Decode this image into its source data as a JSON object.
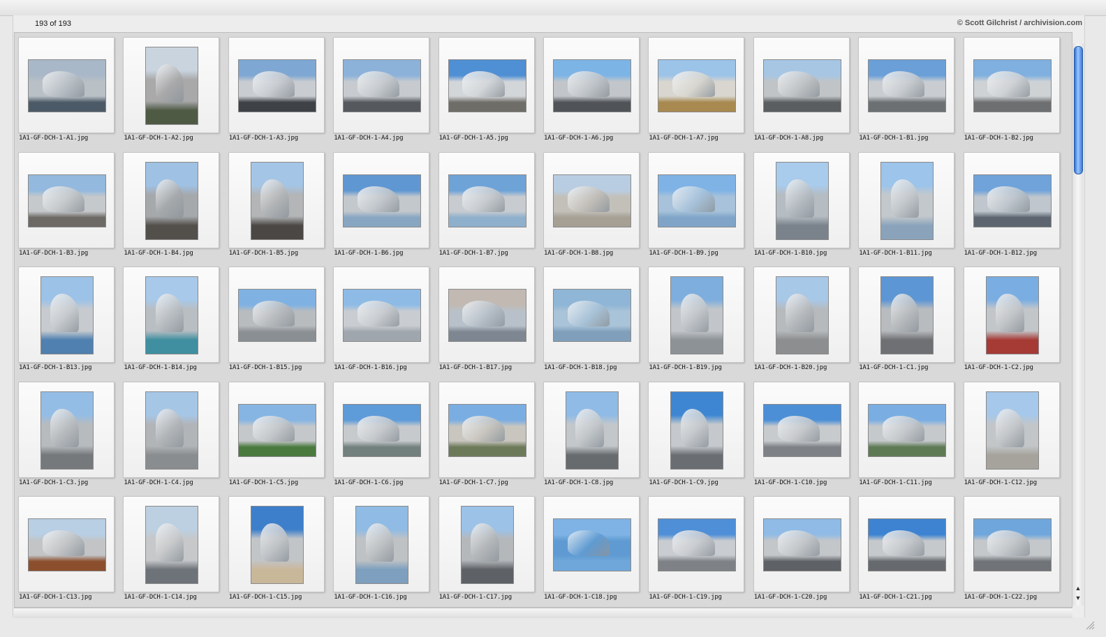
{
  "window": {
    "count_label": "193 of 193",
    "credit": "© Scott Gilchrist / archivision.com"
  },
  "thumbnails": [
    {
      "name": "1A1-GF-DCH-1-A1.jpg",
      "orient": "landscape",
      "palette": [
        "#a9b8c8",
        "#b9c0c6",
        "#4c5a68"
      ]
    },
    {
      "name": "1A1-GF-DCH-1-A2.jpg",
      "orient": "portrait",
      "palette": [
        "#c9d4df",
        "#a9a9aa",
        "#4f5a45"
      ]
    },
    {
      "name": "1A1-GF-DCH-1-A3.jpg",
      "orient": "landscape",
      "palette": [
        "#7fa7d3",
        "#c9ccd1",
        "#3e4247"
      ]
    },
    {
      "name": "1A1-GF-DCH-1-A4.jpg",
      "orient": "landscape",
      "palette": [
        "#8cb2da",
        "#c7cbcf",
        "#55585c"
      ]
    },
    {
      "name": "1A1-GF-DCH-1-A5.jpg",
      "orient": "landscape",
      "palette": [
        "#4f8fd3",
        "#d3d6d9",
        "#6f6d68"
      ]
    },
    {
      "name": "1A1-GF-DCH-1-A6.jpg",
      "orient": "landscape",
      "palette": [
        "#7db4e6",
        "#c2c6ca",
        "#505458"
      ]
    },
    {
      "name": "1A1-GF-DCH-1-A7.jpg",
      "orient": "landscape",
      "palette": [
        "#9cc3e8",
        "#d8d6cf",
        "#a8894f"
      ]
    },
    {
      "name": "1A1-GF-DCH-1-A8.jpg",
      "orient": "landscape",
      "palette": [
        "#a7c6e4",
        "#c1c4c6",
        "#5a5e60"
      ]
    },
    {
      "name": "1A1-GF-DCH-1-B1.jpg",
      "orient": "landscape",
      "palette": [
        "#6a9fd8",
        "#c9cdd1",
        "#6c7072"
      ]
    },
    {
      "name": "1A1-GF-DCH-1-B2.jpg",
      "orient": "landscape",
      "palette": [
        "#7fb0e0",
        "#cfd2d5",
        "#6d6f71"
      ]
    },
    {
      "name": "1A1-GF-DCH-1-B3.jpg",
      "orient": "landscape",
      "palette": [
        "#93b9de",
        "#c6c9cb",
        "#6d6a66"
      ]
    },
    {
      "name": "1A1-GF-DCH-1-B4.jpg",
      "orient": "portrait",
      "palette": [
        "#9fc1e3",
        "#a6a9ac",
        "#534f4b"
      ]
    },
    {
      "name": "1A1-GF-DCH-1-B5.jpg",
      "orient": "portrait",
      "palette": [
        "#a5c5e6",
        "#b3b5b7",
        "#4a4744"
      ]
    },
    {
      "name": "1A1-GF-DCH-1-B6.jpg",
      "orient": "landscape",
      "palette": [
        "#5f97d2",
        "#c3c8cd",
        "#88a6c2"
      ]
    },
    {
      "name": "1A1-GF-DCH-1-B7.jpg",
      "orient": "landscape",
      "palette": [
        "#6ea3d8",
        "#c8ccd0",
        "#8fb0cc"
      ]
    },
    {
      "name": "1A1-GF-DCH-1-B8.jpg",
      "orient": "landscape",
      "palette": [
        "#b9cde2",
        "#c3c0ba",
        "#a59f94"
      ]
    },
    {
      "name": "1A1-GF-DCH-1-B9.jpg",
      "orient": "landscape",
      "palette": [
        "#7fb3e6",
        "#a7c2da",
        "#7fa4c8"
      ]
    },
    {
      "name": "1A1-GF-DCH-1-B10.jpg",
      "orient": "portrait",
      "palette": [
        "#a9cbec",
        "#b5bcc2",
        "#7a838c"
      ]
    },
    {
      "name": "1A1-GF-DCH-1-B11.jpg",
      "orient": "portrait",
      "palette": [
        "#9dc4ea",
        "#c3c8cc",
        "#8aa3bb"
      ]
    },
    {
      "name": "1A1-GF-DCH-1-B12.jpg",
      "orient": "landscape",
      "palette": [
        "#6fa3da",
        "#bfc6cd",
        "#5d6670"
      ]
    },
    {
      "name": "1A1-GF-DCH-1-B13.jpg",
      "orient": "portrait",
      "palette": [
        "#9cc2e8",
        "#c7cbcf",
        "#4f80b0"
      ]
    },
    {
      "name": "1A1-GF-DCH-1-B14.jpg",
      "orient": "portrait",
      "palette": [
        "#a8c9ea",
        "#b9bec3",
        "#3f8fa0"
      ]
    },
    {
      "name": "1A1-GF-DCH-1-B15.jpg",
      "orient": "landscape",
      "palette": [
        "#7fb2e3",
        "#b9bcbf",
        "#8a8f93"
      ]
    },
    {
      "name": "1A1-GF-DCH-1-B16.jpg",
      "orient": "landscape",
      "palette": [
        "#8ebbe6",
        "#c9ccd0",
        "#9fa6ad"
      ]
    },
    {
      "name": "1A1-GF-DCH-1-B17.jpg",
      "orient": "landscape",
      "palette": [
        "#c2b9b2",
        "#b8c1ca",
        "#7e8791"
      ]
    },
    {
      "name": "1A1-GF-DCH-1-B18.jpg",
      "orient": "landscape",
      "palette": [
        "#8fb6d6",
        "#a9c3d8",
        "#7f9fbb"
      ]
    },
    {
      "name": "1A1-GF-DCH-1-B19.jpg",
      "orient": "portrait",
      "palette": [
        "#7eaede",
        "#c2c6ca",
        "#8c9296"
      ]
    },
    {
      "name": "1A1-GF-DCH-1-B20.jpg",
      "orient": "portrait",
      "palette": [
        "#a8c8e8",
        "#b6babd",
        "#8d8e8f"
      ]
    },
    {
      "name": "1A1-GF-DCH-1-C1.jpg",
      "orient": "portrait",
      "palette": [
        "#5d96d4",
        "#b9bcbf",
        "#6f7073"
      ]
    },
    {
      "name": "1A1-GF-DCH-1-C2.jpg",
      "orient": "portrait",
      "palette": [
        "#7aaee2",
        "#c3c6c9",
        "#a63a35"
      ]
    },
    {
      "name": "1A1-GF-DCH-1-C3.jpg",
      "orient": "portrait",
      "palette": [
        "#94bde6",
        "#b8bbbe",
        "#76797c"
      ]
    },
    {
      "name": "1A1-GF-DCH-1-C4.jpg",
      "orient": "portrait",
      "palette": [
        "#a6c6e6",
        "#b2b5b8",
        "#8a8d90"
      ]
    },
    {
      "name": "1A1-GF-DCH-1-C5.jpg",
      "orient": "landscape",
      "palette": [
        "#86b5e3",
        "#c5c8cb",
        "#4b7a3e"
      ]
    },
    {
      "name": "1A1-GF-DCH-1-C6.jpg",
      "orient": "landscape",
      "palette": [
        "#5e9bd9",
        "#c7cacd",
        "#72807e"
      ]
    },
    {
      "name": "1A1-GF-DCH-1-C7.jpg",
      "orient": "landscape",
      "palette": [
        "#7aaee2",
        "#c9c6c0",
        "#6d7a59"
      ]
    },
    {
      "name": "1A1-GF-DCH-1-C8.jpg",
      "orient": "portrait",
      "palette": [
        "#8fbbe6",
        "#c3c7ca",
        "#676b6e"
      ]
    },
    {
      "name": "1A1-GF-DCH-1-C9.jpg",
      "orient": "portrait",
      "palette": [
        "#3e86d2",
        "#c5c8cc",
        "#6a6e72"
      ]
    },
    {
      "name": "1A1-GF-DCH-1-C10.jpg",
      "orient": "landscape",
      "palette": [
        "#4c8fd6",
        "#c8cbce",
        "#7e8186"
      ]
    },
    {
      "name": "1A1-GF-DCH-1-C11.jpg",
      "orient": "landscape",
      "palette": [
        "#7aaee3",
        "#c6c9cc",
        "#5e7a55"
      ]
    },
    {
      "name": "1A1-GF-DCH-1-C12.jpg",
      "orient": "portrait",
      "palette": [
        "#a6c8ea",
        "#c3c6c9",
        "#a5a39c"
      ]
    },
    {
      "name": "1A1-GF-DCH-1-C13.jpg",
      "orient": "landscape",
      "palette": [
        "#b8cfe4",
        "#c2c4c6",
        "#8b4f2d"
      ]
    },
    {
      "name": "1A1-GF-DCH-1-C14.jpg",
      "orient": "portrait",
      "palette": [
        "#bcd0e2",
        "#c6c8ca",
        "#6d7378"
      ]
    },
    {
      "name": "1A1-GF-DCH-1-C15.jpg",
      "orient": "portrait",
      "palette": [
        "#3d7fcb",
        "#c2c5c8",
        "#c9b79a"
      ]
    },
    {
      "name": "1A1-GF-DCH-1-C16.jpg",
      "orient": "portrait",
      "palette": [
        "#8fbbe4",
        "#bfc2c5",
        "#7e9fbe"
      ]
    },
    {
      "name": "1A1-GF-DCH-1-C17.jpg",
      "orient": "portrait",
      "palette": [
        "#9cc2e8",
        "#b5b8bb",
        "#5e6266"
      ]
    },
    {
      "name": "1A1-GF-DCH-1-C18.jpg",
      "orient": "landscape",
      "palette": [
        "#7fb3e6",
        "#5f9bd2",
        "#6fa7da"
      ]
    },
    {
      "name": "1A1-GF-DCH-1-C19.jpg",
      "orient": "landscape",
      "palette": [
        "#4f8fd7",
        "#c9ccd0",
        "#7e8286"
      ]
    },
    {
      "name": "1A1-GF-DCH-1-C20.jpg",
      "orient": "landscape",
      "palette": [
        "#8fbbe6",
        "#c4c7ca",
        "#5e6165"
      ]
    },
    {
      "name": "1A1-GF-DCH-1-C21.jpg",
      "orient": "landscape",
      "palette": [
        "#3d83d2",
        "#c6c9cc",
        "#66696d"
      ]
    },
    {
      "name": "1A1-GF-DCH-1-C22.jpg",
      "orient": "landscape",
      "palette": [
        "#6fa7dc",
        "#c5c8cb",
        "#707377"
      ]
    }
  ]
}
